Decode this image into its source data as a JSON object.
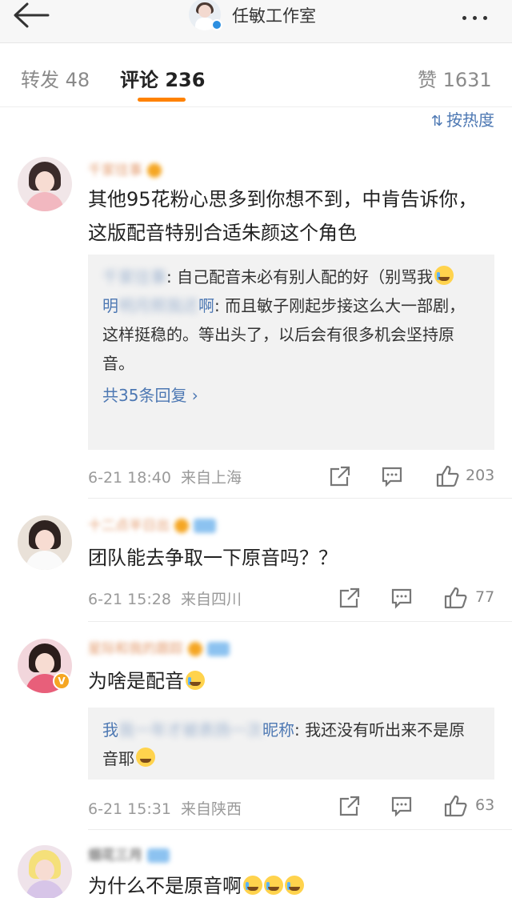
{
  "header": {
    "title": "任敏工作室"
  },
  "tabs": [
    {
      "label": "转发 48"
    },
    {
      "label": "评论 236"
    },
    {
      "label": "赞 1631"
    }
  ],
  "sort_label": "按热度",
  "comments": [
    {
      "name": "千家往事",
      "text": "其他95花粉心思多到你想不到，中肯告诉你，这版配音特别合适朱颜这个角色",
      "replies": [
        {
          "name": "千家往事",
          "text": ": 自己配音未必有别人配的好（别骂我"
        },
        {
          "name_visible": "明",
          "name_blurred": "明月照我还",
          "name_tail": "啊",
          "text": ": 而且敏子刚起步接这么大一部剧，这样挺稳的。等出头了，以后会有很多机会坚持原音。"
        }
      ],
      "more_replies": "共35条回复 ›",
      "time": "6-21 18:40",
      "location": "来自上海",
      "likes": "203"
    },
    {
      "name": "十二点半日出",
      "text": "团队能去争取一下原音吗？？",
      "time": "6-21 15:28",
      "location": "来自四川",
      "likes": "77"
    },
    {
      "name": "星际和我的跟踪",
      "text": "为啥是配音",
      "replies": [
        {
          "name_visible": "我",
          "name_blurred": "我一年才被表扬一次",
          "name_tail": "昵称",
          "text": ": 我还没有听出来不是原音耶"
        }
      ],
      "time": "6-21 15:31",
      "location": "来自陕西",
      "likes": "63"
    },
    {
      "name": "烟花三月",
      "text": "为什么不是原音啊"
    }
  ]
}
